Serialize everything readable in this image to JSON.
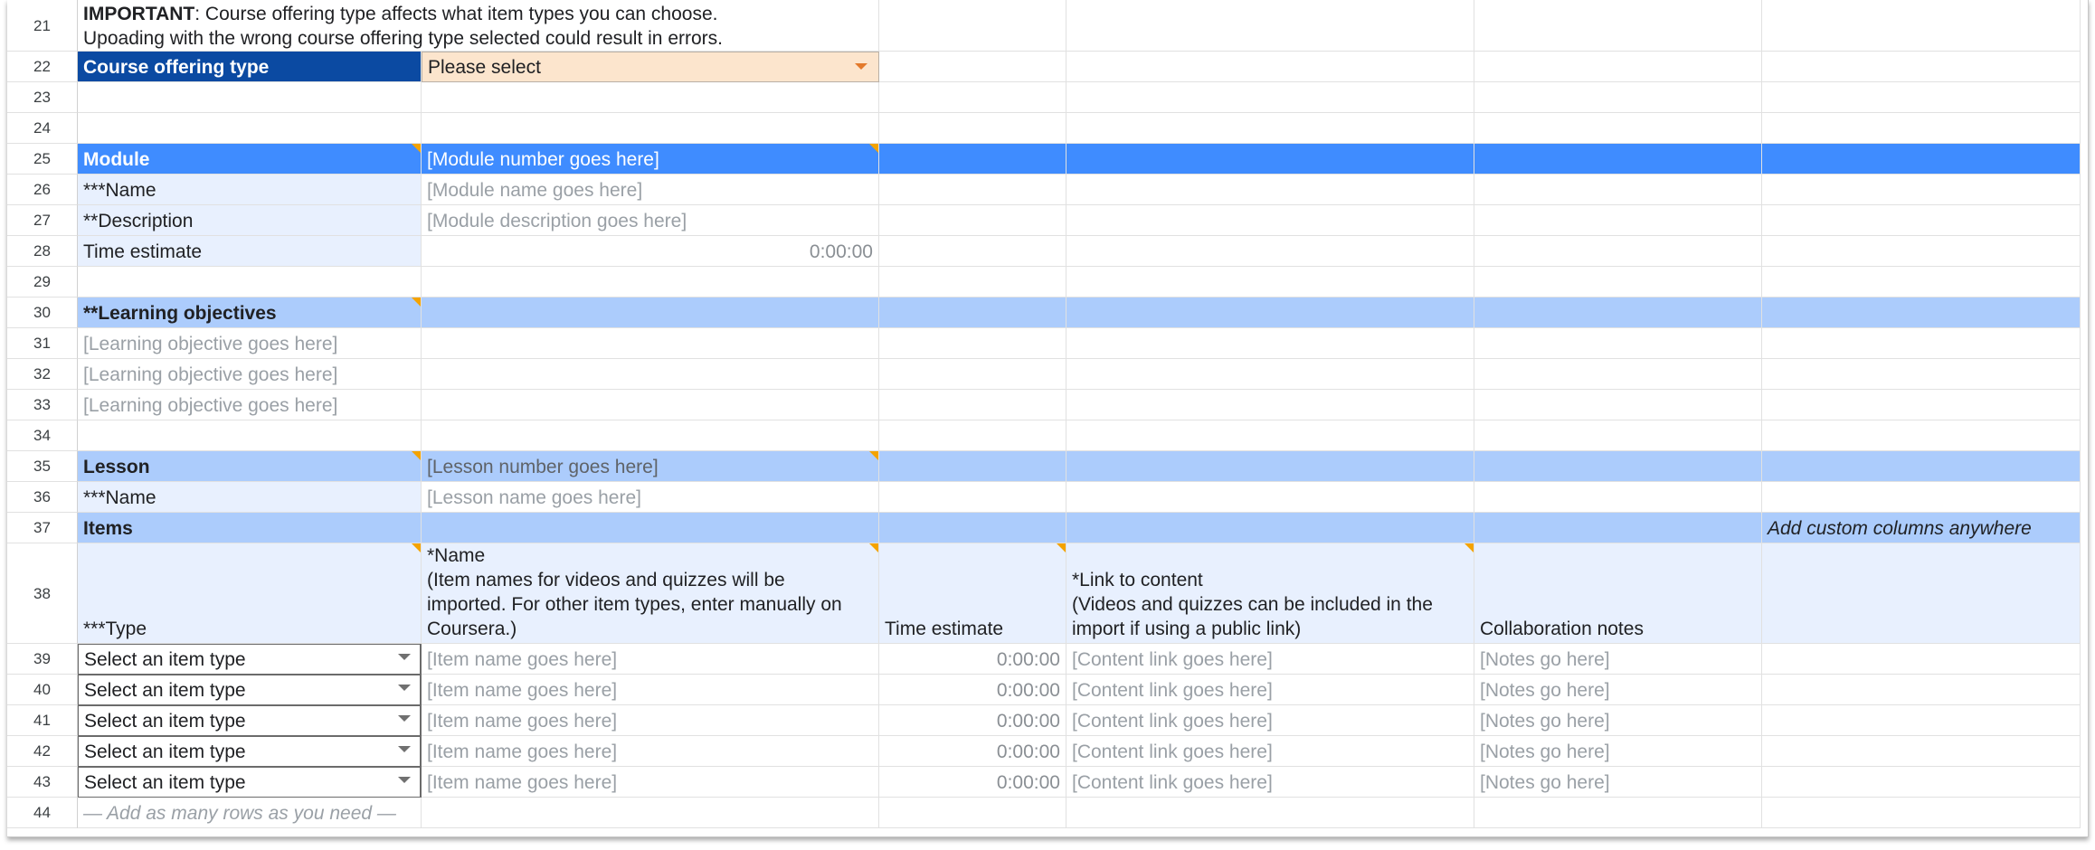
{
  "rows": {
    "r21": "21",
    "r22": "22",
    "r23": "23",
    "r24": "24",
    "r25": "25",
    "r26": "26",
    "r27": "27",
    "r28": "28",
    "r29": "29",
    "r30": "30",
    "r31": "31",
    "r32": "32",
    "r33": "33",
    "r34": "34",
    "r35": "35",
    "r36": "36",
    "r37": "37",
    "r38": "38",
    "r39": "39",
    "r40": "40",
    "r41": "41",
    "r42": "42",
    "r43": "43",
    "r44": "44"
  },
  "important": {
    "label": "IMPORTANT",
    "line1": ": Course offering type affects what item types you can choose.",
    "line2": "Upoading with the wrong course offering type selected could result in errors."
  },
  "offering": {
    "label": "Course offering type",
    "value": "Please select"
  },
  "module": {
    "label": "Module",
    "number_placeholder": "[Module number goes here]",
    "name_label": "***Name",
    "name_placeholder": "[Module name goes here]",
    "description_label": "**Description",
    "description_placeholder": "[Module description goes here]",
    "time_label": "Time estimate",
    "time_value": "0:00:00"
  },
  "objectives": {
    "label": "**Learning objectives",
    "items": [
      "[Learning objective goes here]",
      "[Learning objective goes here]",
      "[Learning objective goes here]"
    ]
  },
  "lesson": {
    "label": "Lesson",
    "number_placeholder": "[Lesson number goes here]",
    "name_label": "***Name",
    "name_placeholder": "[Lesson name goes here]"
  },
  "items": {
    "label": "Items",
    "custom_hint": "Add custom columns anywhere",
    "headers": {
      "type": "***Type",
      "name_l1": "*Name",
      "name_l2": "(Item names for videos and quizzes will be",
      "name_l3": "imported. For other item types, enter manually on",
      "name_l4": "Coursera.)",
      "time": "Time estimate",
      "link_l1": "*Link to content",
      "link_l2": "(Videos and quizzes can be included in the",
      "link_l3": "import if using a public link)",
      "notes": "Collaboration notes"
    },
    "rows": [
      {
        "type": "Select an item type",
        "name": "[Item name goes here]",
        "time": "0:00:00",
        "link": "[Content link goes here]",
        "notes": "[Notes go here]"
      },
      {
        "type": "Select an item type",
        "name": "[Item name goes here]",
        "time": "0:00:00",
        "link": "[Content link goes here]",
        "notes": "[Notes go here]"
      },
      {
        "type": "Select an item type",
        "name": "[Item name goes here]",
        "time": "0:00:00",
        "link": "[Content link goes here]",
        "notes": "[Notes go here]"
      },
      {
        "type": "Select an item type",
        "name": "[Item name goes here]",
        "time": "0:00:00",
        "link": "[Content link goes here]",
        "notes": "[Notes go here]"
      },
      {
        "type": "Select an item type",
        "name": "[Item name goes here]",
        "time": "0:00:00",
        "link": "[Content link goes here]",
        "notes": "[Notes go here]"
      }
    ],
    "add_rows_hint": "— Add as many rows as you need —"
  },
  "colors": {
    "navy": "#0b4aa2",
    "bright_blue": "#3f8cff",
    "light_blue": "#acccfc",
    "pale_blue": "#e8f0fe",
    "peach": "#fce5cd",
    "note_triangle": "#f4a300"
  }
}
